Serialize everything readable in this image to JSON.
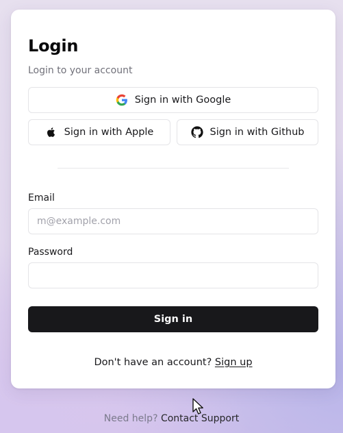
{
  "login": {
    "title": "Login",
    "subtitle": "Login to your account",
    "social": {
      "google_label": "Sign in with Google",
      "apple_label": "Sign in with Apple",
      "github_label": "Sign in with Github",
      "google_icon": "google-icon",
      "apple_icon": "apple-icon",
      "github_icon": "github-icon"
    },
    "email": {
      "label": "Email",
      "value": "",
      "placeholder": "m@example.com"
    },
    "password": {
      "label": "Password",
      "value": "",
      "placeholder": ""
    },
    "submit_label": "Sign in",
    "signup_prompt": "Don't have an account?",
    "signup_link": "Sign up"
  },
  "footer": {
    "help_text": "Need help?",
    "support_link": "Contact Support"
  },
  "colors": {
    "primary_button_bg": "#18181b",
    "primary_button_text": "#fafafa",
    "muted_text": "#71717a",
    "border": "#e4e4e7",
    "card_bg": "#ffffff"
  }
}
